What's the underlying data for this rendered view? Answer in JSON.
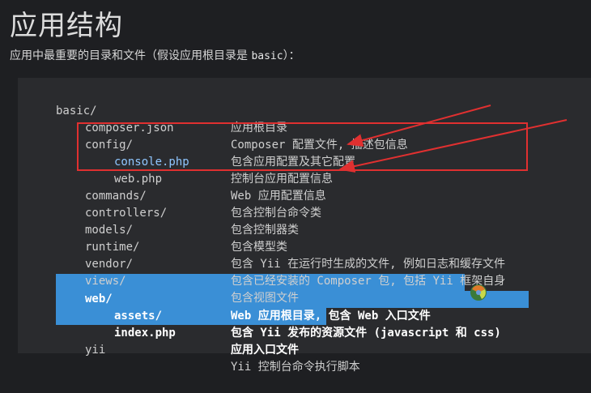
{
  "title": "应用结构",
  "intro": {
    "text_before": "应用中最重要的目录和文件（假设应用根目录是 ",
    "code": "basic",
    "text_after": "）："
  },
  "tree": [
    {
      "path": "basic/",
      "desc": "应用根目录",
      "level": 0
    },
    {
      "path": "composer.json",
      "desc": "Composer 配置文件, 描述包信息",
      "level": 1
    },
    {
      "path": "config/",
      "desc": "包含应用配置及其它配置",
      "level": 1
    },
    {
      "path": "console.php",
      "desc": "控制台应用配置信息",
      "level": 2
    },
    {
      "path": "web.php",
      "desc": "Web 应用配置信息",
      "level": 2
    },
    {
      "path": "commands/",
      "desc": "包含控制台命令类",
      "level": 1
    },
    {
      "path": "controllers/",
      "desc": "包含控制器类",
      "level": 1
    },
    {
      "path": "models/",
      "desc": "包含模型类",
      "level": 1
    },
    {
      "path": "runtime/",
      "desc": "包含 Yii 在运行时生成的文件, 例如日志和缓存文件",
      "level": 1
    },
    {
      "path": "vendor/",
      "desc": "包含已经安装的 Composer 包, 包括 Yii 框架自身",
      "level": 1
    },
    {
      "path": "views/",
      "desc": "包含视图文件",
      "level": 1
    },
    {
      "path": "web/",
      "desc": "Web 应用根目录, 包含 Web 入口文件",
      "level": 1
    },
    {
      "path": "assets/",
      "desc": "包含 Yii 发布的资源文件 (javascript 和 css)",
      "level": 2
    },
    {
      "path": "index.php",
      "desc": "应用入口文件",
      "level": 2
    },
    {
      "path": "yii",
      "desc": "Yii 控制台命令执行脚本",
      "level": 1
    }
  ],
  "colors": {
    "selection": "#3a8fd6",
    "annotation": "#e03030",
    "background": "#1e1f22",
    "code_background": "#2a2b2e"
  }
}
